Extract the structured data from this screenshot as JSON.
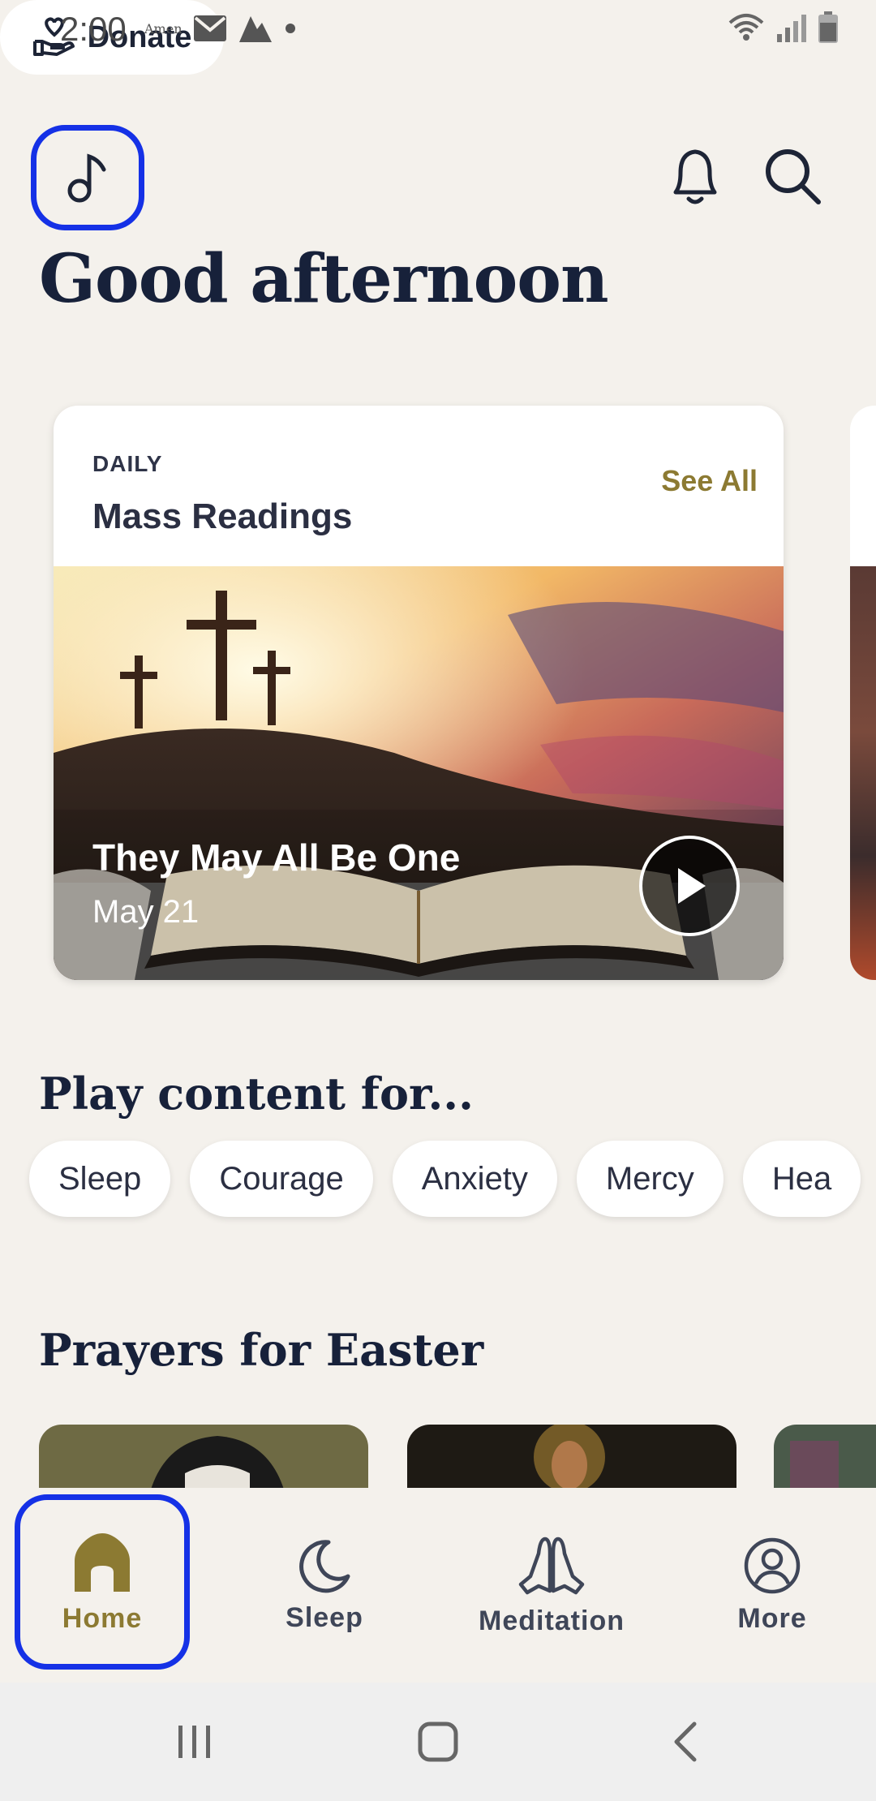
{
  "status_bar": {
    "time": "2:00",
    "app_badge": "Amen"
  },
  "header": {
    "donate_label": "Donate",
    "greeting": "Good afternoon"
  },
  "daily_card": {
    "kicker": "DAILY",
    "title": "Mass Readings",
    "see_all": "See All",
    "item_title": "They May All Be One",
    "item_date": "May 21"
  },
  "play_content": {
    "title": "Play content for...",
    "chips": [
      "Sleep",
      "Courage",
      "Anxiety",
      "Mercy",
      "Hea"
    ]
  },
  "prayers": {
    "title": "Prayers for Easter"
  },
  "tabs": [
    {
      "label": "Home",
      "icon": "home-icon",
      "active": true
    },
    {
      "label": "Sleep",
      "icon": "moon-icon",
      "active": false
    },
    {
      "label": "Meditation",
      "icon": "praying-hands-icon",
      "active": false
    },
    {
      "label": "More",
      "icon": "profile-icon",
      "active": false
    }
  ],
  "colors": {
    "accent": "#8c7a32",
    "background": "#f4f1ec",
    "highlight": "#1531e6",
    "text": "#17213a"
  }
}
